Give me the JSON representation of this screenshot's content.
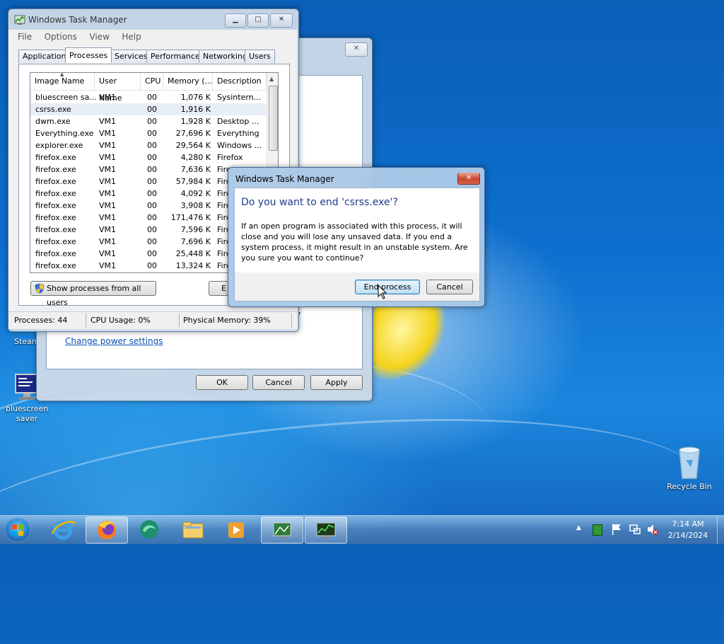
{
  "desktop": {
    "icons": [
      {
        "label": "Stean"
      },
      {
        "label": "bluescreen saver"
      },
      {
        "label": "Recycle Bin"
      }
    ]
  },
  "taskmgr": {
    "title": "Windows Task Manager",
    "menu": [
      "File",
      "Options",
      "View",
      "Help"
    ],
    "tabs": [
      "Applications",
      "Processes",
      "Services",
      "Performance",
      "Networking",
      "Users"
    ],
    "selected_tab": "Processes",
    "columns": [
      "Image Name",
      "User Name",
      "CPU",
      "Memory (...",
      "Description"
    ],
    "rows": [
      [
        "bluescreen sa...",
        "VM1",
        "00",
        "1,076 K",
        "Sysintern..."
      ],
      [
        "csrss.exe",
        "",
        "00",
        "1,916 K",
        ""
      ],
      [
        "dwm.exe",
        "VM1",
        "00",
        "1,928 K",
        "Desktop ..."
      ],
      [
        "Everything.exe",
        "VM1",
        "00",
        "27,696 K",
        "Everything"
      ],
      [
        "explorer.exe",
        "VM1",
        "00",
        "29,564 K",
        "Windows ..."
      ],
      [
        "firefox.exe",
        "VM1",
        "00",
        "4,280 K",
        "Firefox"
      ],
      [
        "firefox.exe",
        "VM1",
        "00",
        "7,636 K",
        "Fire"
      ],
      [
        "firefox.exe",
        "VM1",
        "00",
        "57,984 K",
        "Fire"
      ],
      [
        "firefox.exe",
        "VM1",
        "00",
        "4,092 K",
        "Fire"
      ],
      [
        "firefox.exe",
        "VM1",
        "00",
        "3,908 K",
        "Fire"
      ],
      [
        "firefox.exe",
        "VM1",
        "00",
        "171,476 K",
        "Fire"
      ],
      [
        "firefox.exe",
        "VM1",
        "00",
        "7,596 K",
        "Fire"
      ],
      [
        "firefox.exe",
        "VM1",
        "00",
        "7,696 K",
        "Fire"
      ],
      [
        "firefox.exe",
        "VM1",
        "00",
        "25,448 K",
        "Fire"
      ],
      [
        "firefox.exe",
        "VM1",
        "00",
        "13,324 K",
        "Fire"
      ]
    ],
    "show_all_label": "Show processes from all users",
    "end_partial": "E",
    "status": {
      "processes": "Processes: 44",
      "cpu": "CPU Usage: 0%",
      "memory": "Physical Memory: 39%"
    }
  },
  "power_window": {
    "link": "Change power settings",
    "ok": "OK",
    "cancel": "Cancel",
    "apply": "Apply",
    "stray_char": "y"
  },
  "dialog": {
    "title": "Windows Task Manager",
    "heading": "Do you want to end 'csrss.exe'?",
    "body": "If an open program is associated with this process, it will close and you will lose any unsaved data. If you end a system process, it might result in an unstable system. Are you sure you want to continue?",
    "end_button": "End process",
    "cancel_button": "Cancel"
  },
  "clock": {
    "time": "7:14 AM",
    "date": "2/14/2024"
  },
  "taskbar": {
    "apps": [
      "internet-explorer",
      "firefox",
      "browser-app",
      "file-explorer",
      "media-player",
      "screensaver-app",
      "task-manager"
    ],
    "active_apps": [
      "firefox",
      "screensaver-app",
      "task-manager"
    ]
  }
}
